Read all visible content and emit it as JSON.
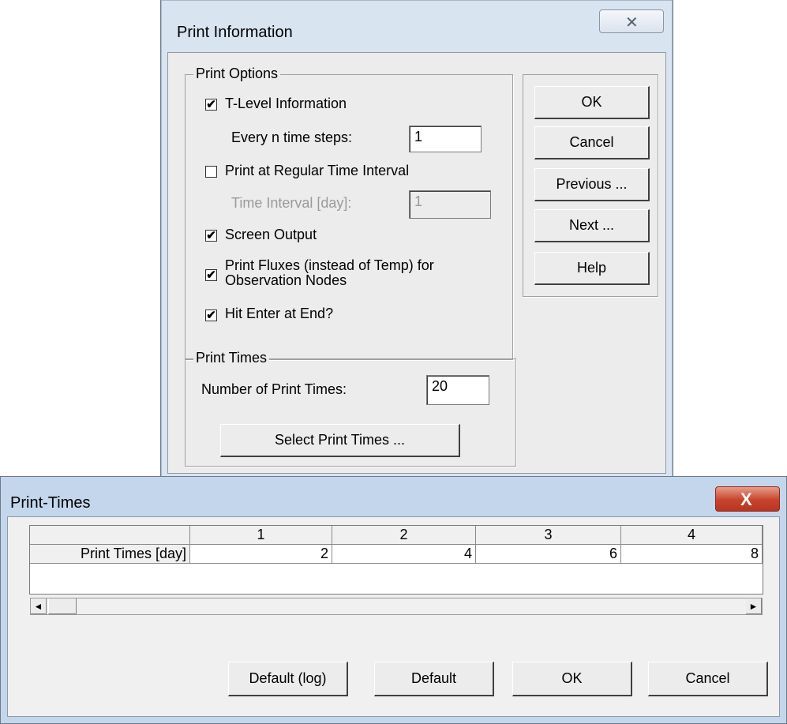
{
  "print_information": {
    "title": "Print Information",
    "close_glyph": "✕",
    "print_options": {
      "label": "Print Options",
      "t_level": {
        "label": "T-Level Information",
        "checked": true
      },
      "every_n": {
        "label": "Every n time steps:",
        "value": "1"
      },
      "regular_interval": {
        "label": "Print at Regular Time Interval",
        "checked": false
      },
      "time_interval": {
        "label": "Time Interval [day]:",
        "value": "1",
        "disabled": true
      },
      "screen_output": {
        "label": "Screen Output",
        "checked": true
      },
      "print_fluxes": {
        "label_line1": "Print Fluxes (instead of Temp) for",
        "label_line2": "Observation Nodes",
        "checked": true
      },
      "hit_enter": {
        "label": "Hit Enter at End?",
        "checked": true
      }
    },
    "print_times": {
      "label": "Print Times",
      "number_label": "Number of Print Times:",
      "number_value": "20",
      "select_button": "Select Print Times ..."
    },
    "buttons": {
      "ok": "OK",
      "cancel": "Cancel",
      "previous": "Previous ...",
      "next": "Next ...",
      "help": "Help"
    }
  },
  "print_times_window": {
    "title": "Print-Times",
    "close_glyph": "X",
    "grid": {
      "columns": [
        "1",
        "2",
        "3",
        "4"
      ],
      "row_label": "Print Times [day]",
      "values": [
        "2",
        "4",
        "6",
        "8"
      ]
    },
    "scroll_left": "◄",
    "scroll_right": "►",
    "buttons": {
      "default_log": "Default (log)",
      "default": "Default",
      "ok": "OK",
      "cancel": "Cancel"
    }
  },
  "checkmark": "✔",
  "colors": {
    "title_bar": "#d9e4f1",
    "dialog_bg": "#ececec",
    "close_red": "#c7432b"
  }
}
